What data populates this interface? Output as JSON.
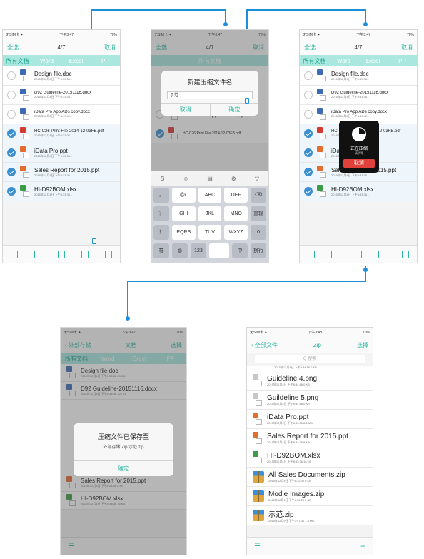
{
  "screens": {
    "s1": {
      "status": {
        "carrier": "无SIM卡 ✦",
        "time": "下午3:47",
        "battery": "70%"
      },
      "nav": {
        "left": "全选",
        "title": "4/7",
        "right": "取消"
      },
      "tabs": [
        "所有文档",
        "Word",
        "Excel",
        "PP"
      ],
      "files": [
        {
          "name": "Design file.doc",
          "meta": "2015年12月4日 下午8:33:36...",
          "type": "doc",
          "selected": false
        },
        {
          "name": "D92 Guideline-20151116.docx",
          "meta": "2015年12月4日 下午8:33:36...",
          "type": "doc",
          "selected": false
        },
        {
          "name": "iData Pro App ADs copy.docx",
          "meta": "2015年12月2日 下午4:49:42...",
          "type": "doc",
          "selected": false
        },
        {
          "name": "HC-C26 Print File-2014-12-03FB.pdf",
          "meta": "2015年12月4日 下午8:33:36...",
          "type": "pdf",
          "selected": true
        },
        {
          "name": "iData Pro.ppt",
          "meta": "2015年12月4日 下午8:33:36...",
          "type": "ppt",
          "selected": true
        },
        {
          "name": "Sales Report for 2015.ppt",
          "meta": "2015年12月4日 下午8:33:36...",
          "type": "ppt",
          "selected": true
        },
        {
          "name": "HI-D92BOM.xlsx",
          "meta": "2015年12月4日 下午8:33:36...",
          "type": "xls",
          "selected": true
        }
      ]
    },
    "s2": {
      "dialog": {
        "title": "新建压缩文件名",
        "value": "示范",
        "cancel": "取消",
        "ok": "确定"
      },
      "bg_files": [
        "iData Pro App ADs copy.docx",
        "HC-C26 Print File-2014-12-03FB.pdf"
      ],
      "keys": {
        "row1": [
          "@/.",
          "ABC",
          "DEF",
          "⌫"
        ],
        "row2": [
          "GHI",
          "JKL",
          "MNO",
          "重输"
        ],
        "row3": [
          "PQRS",
          "TUV",
          "WXYZ",
          "0"
        ],
        "row4": [
          "符",
          "123",
          "中",
          "换行"
        ],
        "side": [
          "，",
          "？",
          "！"
        ]
      }
    },
    "s3": {
      "hud": {
        "line1": "正在压缩",
        "line2": "请稍等",
        "cancel": "取消"
      }
    },
    "s4": {
      "status": {
        "carrier": "无SIM卡 ✦",
        "time": "下午3:47",
        "battery": "70%"
      },
      "nav": {
        "back": "外部存储",
        "title": "文档",
        "right": "选择"
      },
      "tabs": [
        "所有文档",
        "Word",
        "Excel",
        "PP"
      ],
      "files": [
        {
          "name": "Design file.doc",
          "meta": "2015年12月4日 下午8:33:36   23 KB",
          "type": "doc"
        },
        {
          "name": "D92 Guideline-20151116.docx",
          "meta": "2015年12月4日 下午8:33:36   329 KB",
          "type": "doc"
        },
        {
          "name": "Sales Report for 2015.ppt",
          "meta": "2015年12月4日 下午8:33:36   8 KB",
          "type": "ppt"
        },
        {
          "name": "HI-D92BOM.xlsx",
          "meta": "2015年12月4日 下午8:33:36   16 KB",
          "type": "xls"
        }
      ],
      "dialog": {
        "title": "压缩文件已保存至",
        "path": "外部存储:Zip/示范.zip",
        "ok": "确定"
      }
    },
    "s5": {
      "status": {
        "carrier": "无SIM卡 ✦",
        "time": "下午3:48",
        "battery": "70%"
      },
      "nav": {
        "back": "全部文件",
        "title": "Zip",
        "right": "选择"
      },
      "search_placeholder": "Q 搜索",
      "top_meta": "2015年12月4日 下午8:34:16   0 KB",
      "files": [
        {
          "name": "Guideline 4.png",
          "meta": "2015年12月4日 下午8:34:16   0 KB",
          "type": "png"
        },
        {
          "name": "Guildeline 5.png",
          "meta": "2015年12月4日 下午8:34:16   0 KB",
          "type": "png"
        },
        {
          "name": "iData Pro.ppt",
          "meta": "2015年12月4日 下午8:33:36   8.1 MB",
          "type": "ppt"
        },
        {
          "name": "Sales Report for 2015.ppt",
          "meta": "2015年12月4日 下午8:33:36   8 KB",
          "type": "ppt"
        },
        {
          "name": "HI-D92BOM.xlsx",
          "meta": "2015年12月4日 下午8:33:36   16 KB",
          "type": "xls"
        },
        {
          "name": "All Sales Documents.zip",
          "meta": "2015年12月4日 下午8:32:00   0 KB",
          "type": "zip"
        },
        {
          "name": "Modle Images.zip",
          "meta": "2015年12月4日 下午8:32:28   0 KB",
          "type": "zip"
        },
        {
          "name": "示范.zip",
          "meta": "2015年12月9日 下午3:47:36   7.8 MB",
          "type": "zip"
        }
      ]
    }
  },
  "colors": {
    "accent": "#2fb9a3",
    "connector": "#1c8fd8",
    "selected_check": "#3b8fd0",
    "cancel_red": "#e0413b"
  }
}
